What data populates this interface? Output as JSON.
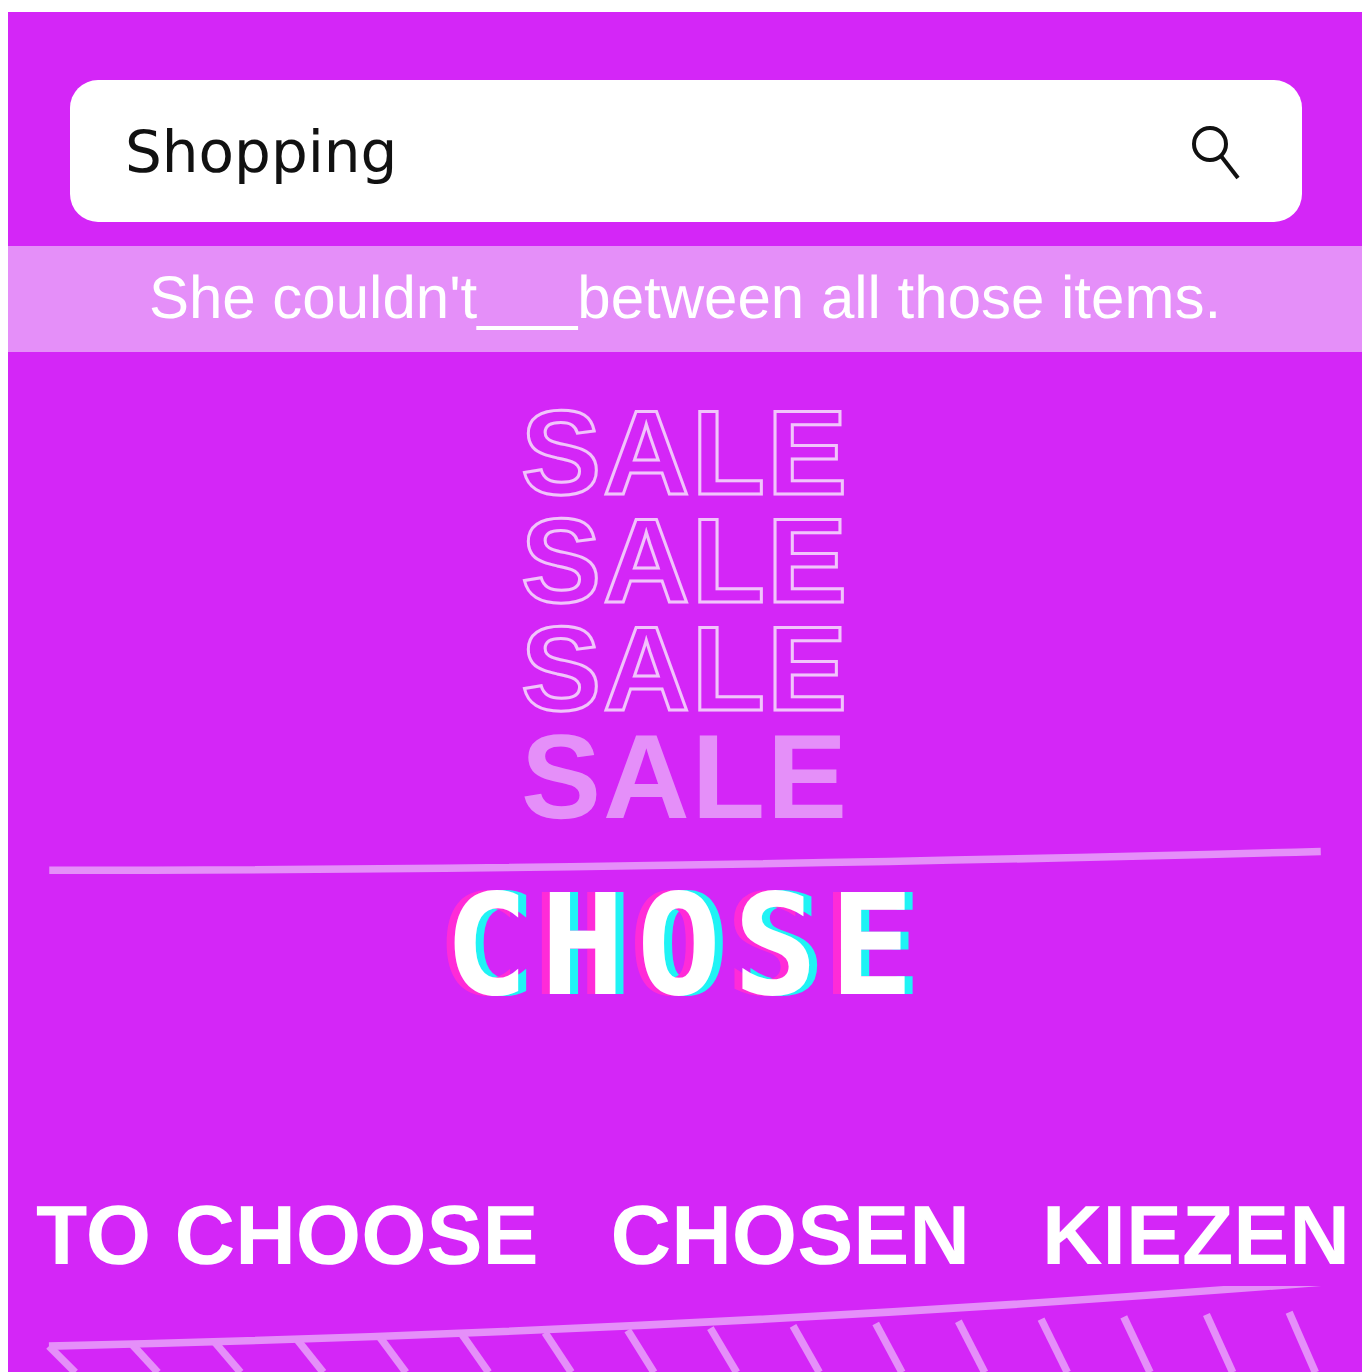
{
  "search": {
    "value": "Shopping"
  },
  "sentence": "She couldn't___between all those items.",
  "sale_words": [
    {
      "text": "SALE",
      "kind": "outline"
    },
    {
      "text": "SALE",
      "kind": "outline"
    },
    {
      "text": "SALE",
      "kind": "outline"
    },
    {
      "text": "SALE",
      "kind": "filled"
    }
  ],
  "answer_word": "CHOSE",
  "options": [
    "TO CHOOSE",
    "CHOSEN",
    "KIEZEN"
  ]
}
